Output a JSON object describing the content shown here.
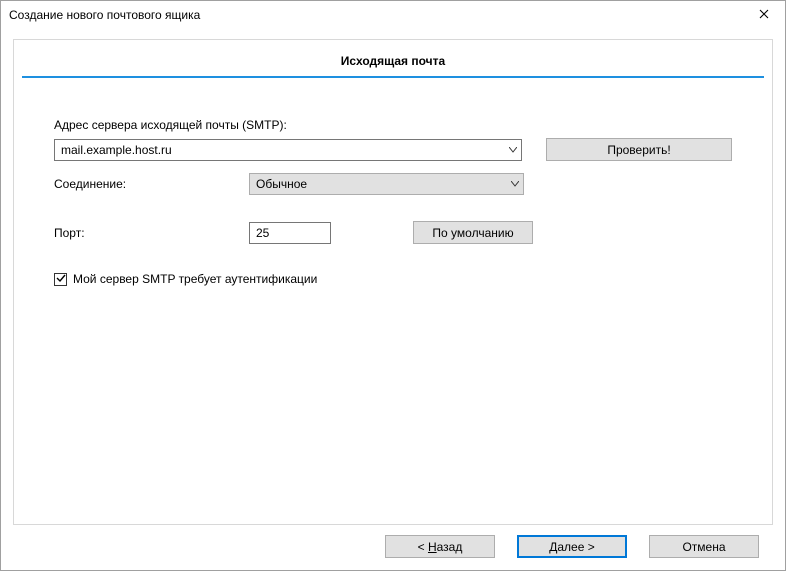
{
  "window": {
    "title": "Создание нового почтового ящика"
  },
  "panel": {
    "header": "Исходящая почта"
  },
  "form": {
    "server_label": "Адрес сервера исходящей почты (SMTP):",
    "server_value": "mail.example.host.ru",
    "verify_button": "Проверить!",
    "connection_label": "Соединение:",
    "connection_value": "Обычное",
    "port_label": "Порт:",
    "port_value": "25",
    "default_port_button": "По умолчанию",
    "auth_checkbox_label": "Мой сервер SMTP требует аутентификации",
    "auth_checkbox_checked": true
  },
  "footer": {
    "back_prefix": "<  ",
    "back_letter": "Н",
    "back_rest": "азад",
    "next_label": "Далее  >",
    "cancel_label": "Отмена"
  }
}
